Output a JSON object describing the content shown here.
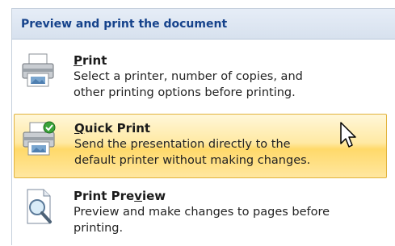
{
  "header": {
    "title": "Preview and print the document"
  },
  "items": [
    {
      "title_pre": "",
      "title_ul": "P",
      "title_post": "rint",
      "desc_line1": "Select a printer, number of copies, and",
      "desc_line2": "other printing options before printing.",
      "icon": "printer-icon"
    },
    {
      "title_pre": "",
      "title_ul": "Q",
      "title_post": "uick Print",
      "desc_line1": "Send the presentation directly to the",
      "desc_line2": "default printer without making changes.",
      "icon": "quick-print-icon",
      "highlighted": true
    },
    {
      "title_pre": "Print Pre",
      "title_ul": "v",
      "title_post": "iew",
      "desc_line1": "Preview and make changes to pages before",
      "desc_line2": "printing.",
      "icon": "print-preview-icon"
    }
  ],
  "colors": {
    "header_text": "#15428b",
    "hover_top": "#fff7d9",
    "hover_bottom": "#ffd96a",
    "hover_border": "#e1b33c"
  }
}
